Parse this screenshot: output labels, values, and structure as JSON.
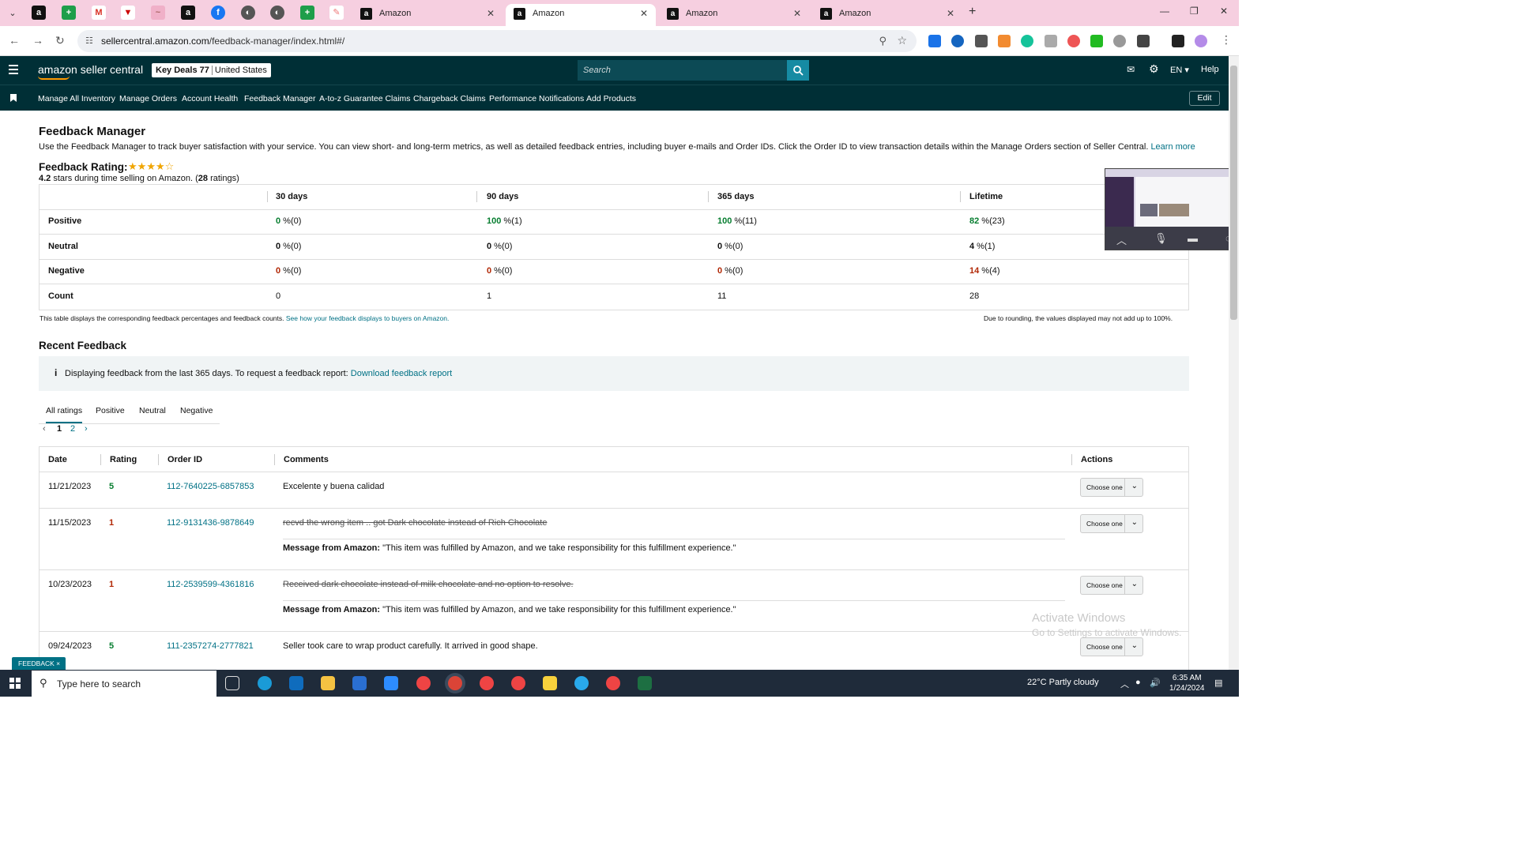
{
  "browser": {
    "tabs": [
      {
        "title": "Amazon",
        "active": false
      },
      {
        "title": "Amazon",
        "active": true
      },
      {
        "title": "Amazon",
        "active": false
      },
      {
        "title": "Amazon",
        "active": false
      }
    ],
    "url_host": "sellercentral.amazon.com",
    "url_path": "/feedback-manager/index.html#/"
  },
  "header": {
    "logo_text": "amazon seller central",
    "store_name": "Key Deals 77",
    "marketplace": "United States",
    "search_placeholder": "Search",
    "language": "EN",
    "help": "Help"
  },
  "nav": {
    "links": [
      "Manage All Inventory",
      "Manage Orders",
      "Account Health",
      "Feedback Manager",
      "A-to-z Guarantee Claims",
      "Chargeback Claims",
      "Performance Notifications",
      "Add Products"
    ],
    "edit": "Edit"
  },
  "page": {
    "title": "Feedback Manager",
    "intro": "Use the Feedback Manager to track buyer satisfaction with your service. You can view short- and long-term metrics, as well as detailed feedback entries, including buyer e-mails and Order IDs. Click the Order ID to view transaction details within the Manage Orders section of Seller Central.",
    "learn_more": "Learn more",
    "rating_title": "Feedback Rating:",
    "stars_value": 4.2,
    "rating_value": "4.2",
    "rating_mid": " stars during time selling on Amazon. (",
    "rating_count": "28",
    "rating_end": " ratings)"
  },
  "metrics": {
    "headers": [
      "30 days",
      "90 days",
      "365 days",
      "Lifetime"
    ],
    "rows": [
      {
        "label": "Positive",
        "cells": [
          {
            "pct": "0",
            "rest": " %(0)",
            "tone": "g"
          },
          {
            "pct": "100",
            "rest": " %(1)",
            "tone": "g"
          },
          {
            "pct": "100",
            "rest": " %(11)",
            "tone": "g"
          },
          {
            "pct": "82",
            "rest": " %(23)",
            "tone": "g"
          }
        ]
      },
      {
        "label": "Neutral",
        "cells": [
          {
            "pct": "0",
            "rest": " %(0)",
            "tone": "z"
          },
          {
            "pct": "0",
            "rest": " %(0)",
            "tone": "z"
          },
          {
            "pct": "0",
            "rest": " %(0)",
            "tone": "z"
          },
          {
            "pct": "4",
            "rest": " %(1)",
            "tone": "z"
          }
        ]
      },
      {
        "label": "Negative",
        "cells": [
          {
            "pct": "0",
            "rest": " %(0)",
            "tone": "r"
          },
          {
            "pct": "0",
            "rest": " %(0)",
            "tone": "r"
          },
          {
            "pct": "0",
            "rest": " %(0)",
            "tone": "r"
          },
          {
            "pct": "14",
            "rest": " %(4)",
            "tone": "r"
          }
        ]
      },
      {
        "label": "Count",
        "cells": [
          {
            "pct": "",
            "rest": "0",
            "tone": "z"
          },
          {
            "pct": "",
            "rest": "1",
            "tone": "z"
          },
          {
            "pct": "",
            "rest": "11",
            "tone": "z"
          },
          {
            "pct": "",
            "rest": "28",
            "tone": "z"
          }
        ]
      }
    ],
    "note_left": "This table displays the corresponding feedback percentages and feedback counts.",
    "note_link": "See how your feedback displays to buyers on Amazon.",
    "note_right": "Due to rounding, the values displayed may not add up to 100%."
  },
  "recent": {
    "title": "Recent Feedback",
    "info_text": "Displaying feedback from the last 365 days. To request a feedback report:",
    "info_link": "Download feedback report",
    "tabs": [
      "All ratings",
      "Positive",
      "Neutral",
      "Negative"
    ],
    "pages": [
      "1",
      "2"
    ],
    "columns": [
      "Date",
      "Rating",
      "Order ID",
      "Comments",
      "Actions"
    ],
    "rows": [
      {
        "date": "11/21/2023",
        "rating": "5",
        "order": "112-7640225-6857853",
        "comment": "Excelente y buena calidad",
        "struck": false,
        "message": ""
      },
      {
        "date": "11/15/2023",
        "rating": "1",
        "order": "112-9131436-9878649",
        "comment": "recvd the wrong item .. got Dark chocolate instead of Rich Chocolate",
        "struck": true,
        "message": "\"This item was fulfilled by Amazon, and we take responsibility for this fulfillment experience.\""
      },
      {
        "date": "10/23/2023",
        "rating": "1",
        "order": "112-2539599-4361816",
        "comment": "Received dark chocolate instead of milk chocolate and no option to resolve.",
        "struck": true,
        "message": "\"This item was fulfilled by Amazon, and we take responsibility for this fulfillment experience.\""
      },
      {
        "date": "09/24/2023",
        "rating": "5",
        "order": "111-2357274-2777821",
        "comment": "Seller took care to wrap product carefully. It arrived in good shape.",
        "struck": false,
        "message": ""
      }
    ],
    "message_label": "Message from Amazon:",
    "action_label": "Choose one"
  },
  "feedback_tab": "FEEDBACK ×",
  "watermark": {
    "line1": "Activate Windows",
    "line2": "Go to Settings to activate Windows."
  },
  "taskbar": {
    "search": "Type here to search",
    "weather": "22°C  Partly cloudy",
    "time": "6:35 AM",
    "date": "1/24/2024"
  },
  "colors": {
    "header_bg": "#002f36",
    "link": "#007185",
    "positive": "#067d2f",
    "negative": "#b12704",
    "star": "#f0a500",
    "tabbar": "#f6cfe0"
  }
}
